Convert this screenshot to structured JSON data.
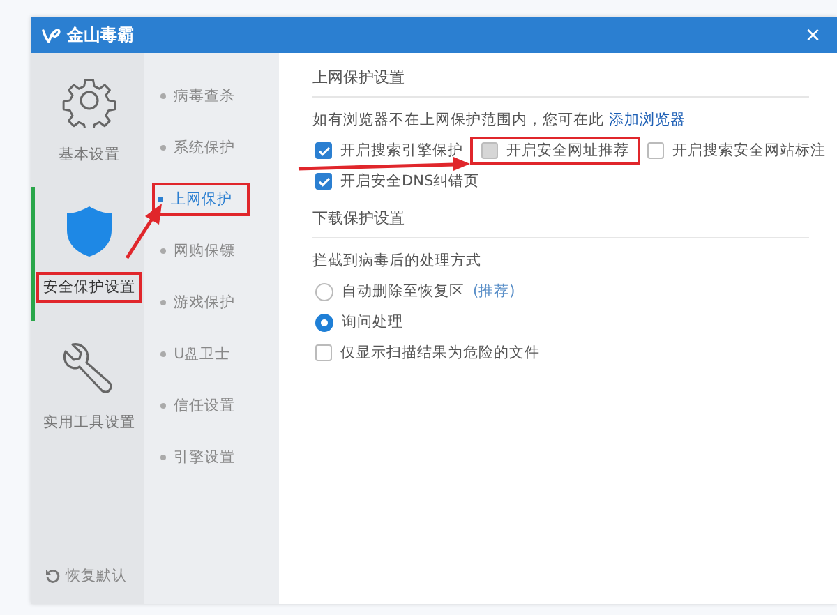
{
  "window": {
    "title": "金山毒霸",
    "close": "×"
  },
  "categories": [
    {
      "label": "基本设置",
      "kind": "gear",
      "selected": false,
      "highlighted": false
    },
    {
      "label": "安全保护设置",
      "kind": "shield",
      "selected": true,
      "highlighted": true
    },
    {
      "label": "实用工具设置",
      "kind": "wrench",
      "selected": false,
      "highlighted": false
    }
  ],
  "restore_defaults": "恢复默认",
  "subnav": [
    {
      "label": "病毒查杀",
      "selected": false,
      "highlighted": false
    },
    {
      "label": "系统保护",
      "selected": false,
      "highlighted": false
    },
    {
      "label": "上网保护",
      "selected": true,
      "highlighted": true
    },
    {
      "label": "网购保镖",
      "selected": false,
      "highlighted": false
    },
    {
      "label": "游戏保护",
      "selected": false,
      "highlighted": false
    },
    {
      "label": "U盘卫士",
      "selected": false,
      "highlighted": false
    },
    {
      "label": "信任设置",
      "selected": false,
      "highlighted": false
    },
    {
      "label": "引擎设置",
      "selected": false,
      "highlighted": false
    }
  ],
  "sections": [
    {
      "title": "上网保护设置",
      "description": "如有浏览器不在上网保护范围内，您可在此",
      "link": "添加浏览器",
      "rows": [
        [
          {
            "kind": "checkbox",
            "label": "开启搜索引擎保护",
            "checked": true,
            "disabled": false,
            "highlighted": false
          },
          {
            "kind": "checkbox",
            "label": "开启安全网址推荐",
            "checked": false,
            "disabled": true,
            "highlighted": true
          },
          {
            "kind": "checkbox",
            "label": "开启搜索安全网站标注",
            "checked": false,
            "disabled": false,
            "highlighted": false
          }
        ],
        [
          {
            "kind": "checkbox",
            "label": "开启安全DNS纠错页",
            "checked": true,
            "disabled": false,
            "highlighted": false
          }
        ]
      ]
    },
    {
      "title": "下载保护设置",
      "description": "拦截到病毒后的处理方式",
      "rows": [
        [
          {
            "kind": "radio",
            "label": "自动删除至恢复区",
            "note": "(推荐)",
            "selected": false
          }
        ],
        [
          {
            "kind": "radio",
            "label": "询问处理",
            "selected": true
          }
        ],
        [
          {
            "kind": "checkbox",
            "label": "仅显示扫描结果为危险的文件",
            "checked": false,
            "disabled": false,
            "highlighted": false
          }
        ]
      ]
    }
  ]
}
